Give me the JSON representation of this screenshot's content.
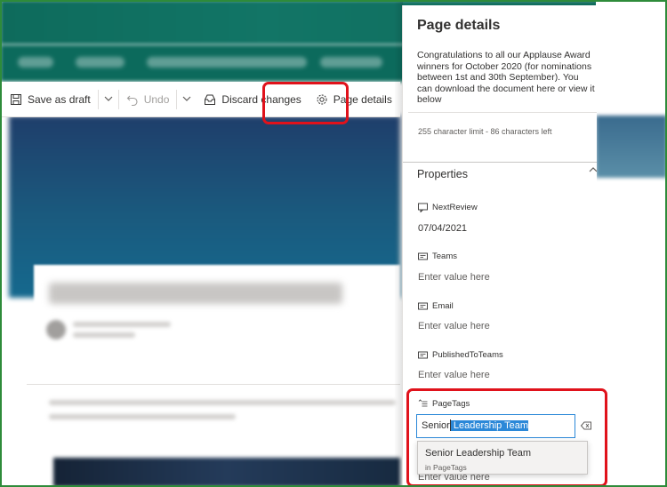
{
  "command_bar": {
    "save_draft": "Save as draft",
    "undo": "Undo",
    "discard": "Discard changes",
    "page_details": "Page details"
  },
  "panel": {
    "title": "Page details",
    "description": "Congratulations to all our Applause Award winners for October 2020 (for nominations between 1st and 30th September). You can download the document here or view it below",
    "char_limit": "255 character limit - 86 characters left",
    "properties_heading": "Properties",
    "fields": [
      {
        "label": "NextReview",
        "value": "07/04/2021"
      },
      {
        "label": "Teams",
        "value": "Enter value here"
      },
      {
        "label": "Email",
        "value": "Enter value here"
      },
      {
        "label": "PublishedToTeams",
        "value": "Enter value here"
      },
      {
        "label": "PageTags",
        "value": "Enter value here"
      }
    ],
    "tag_input": {
      "typed": "Senior",
      "selected": " Leadership Team"
    },
    "suggestion": {
      "main": "Senior Leadership Team",
      "sub": "in PageTags"
    }
  },
  "colors": {
    "accent": "#2b88d8",
    "annotation": "#e0121b",
    "suite_bar": "#0e6b5c"
  }
}
